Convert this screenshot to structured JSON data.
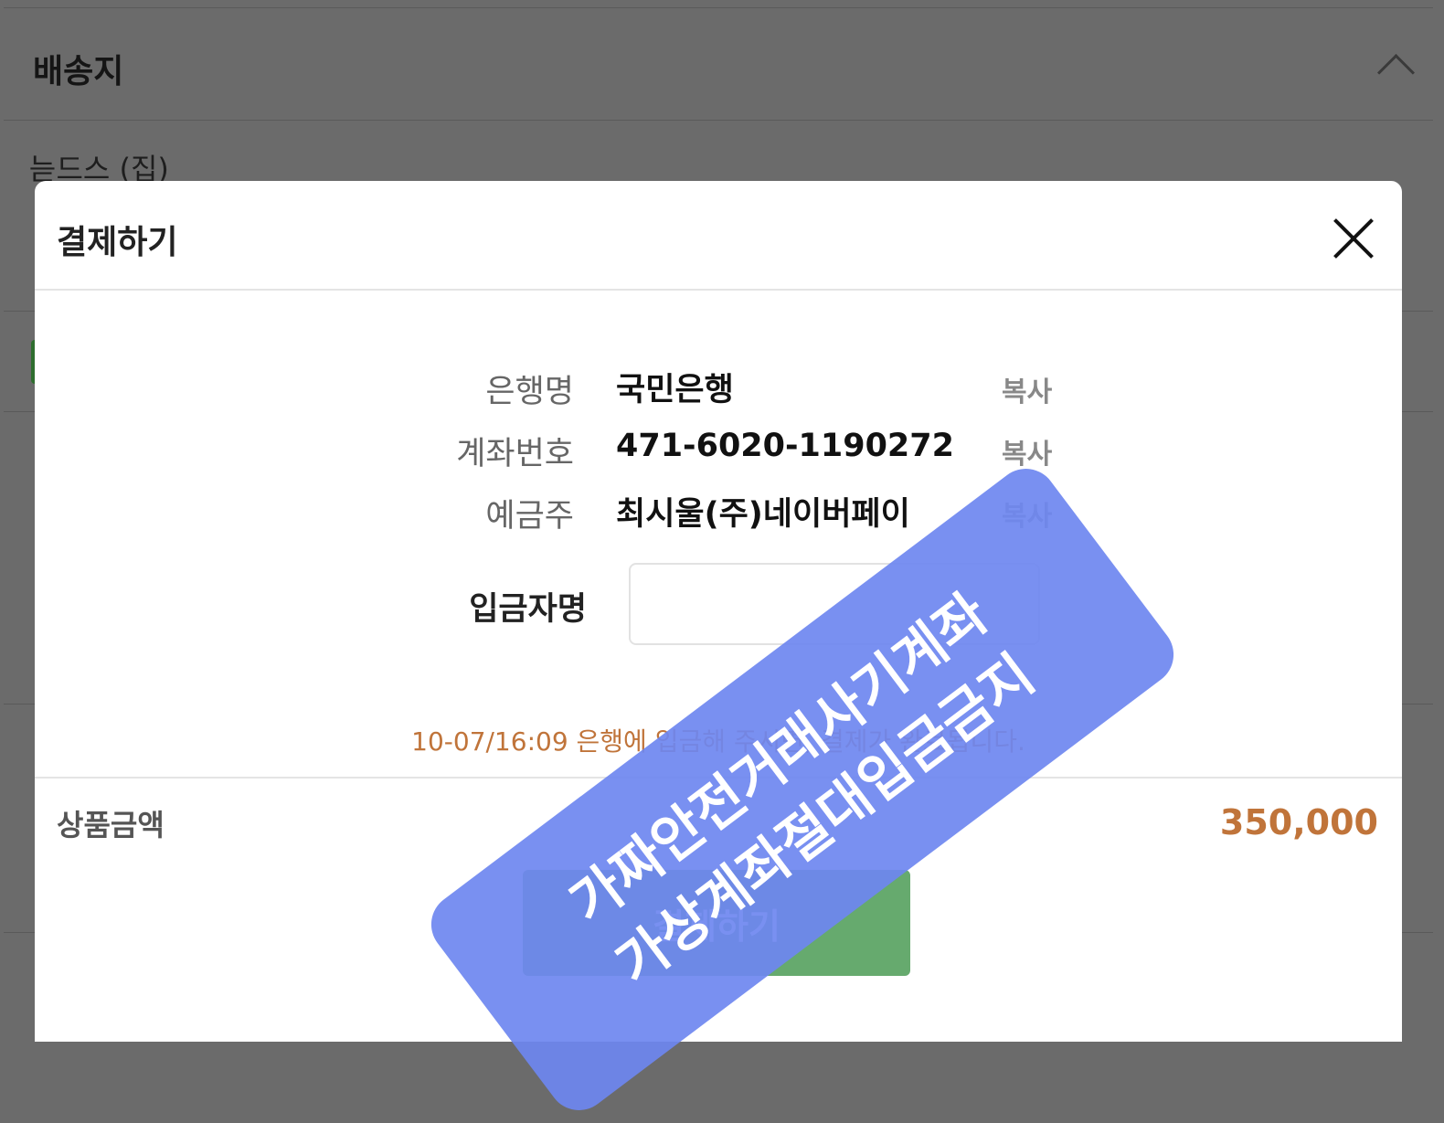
{
  "background": {
    "section_title": "배송지",
    "address_name": "늗드스 (집)"
  },
  "modal": {
    "title": "결제하기",
    "bank_info": [
      {
        "label": "은행명",
        "value": "국민은행",
        "copy": "복사"
      },
      {
        "label": "계좌번호",
        "value": "471-6020-1190272",
        "copy": "복사"
      },
      {
        "label": "예금주",
        "value": "최시울(주)네이버페이",
        "copy": "복사"
      }
    ],
    "depositor_label": "입금자명",
    "depositor_value": "",
    "notice": "10-07/16:09 은행에 입금해 주시면, 결제가 완료됩니다.",
    "price_label": "상품금액",
    "price_value": "350,000",
    "pay_button": "결제하기"
  },
  "stamp": {
    "line1": "가짜안전거래사기계좌",
    "line2": "가상계좌절대입금금지"
  },
  "colors": {
    "accent_price": "#c0743a",
    "pay_button": "#66aa6e",
    "stamp": "#6e87f0"
  }
}
